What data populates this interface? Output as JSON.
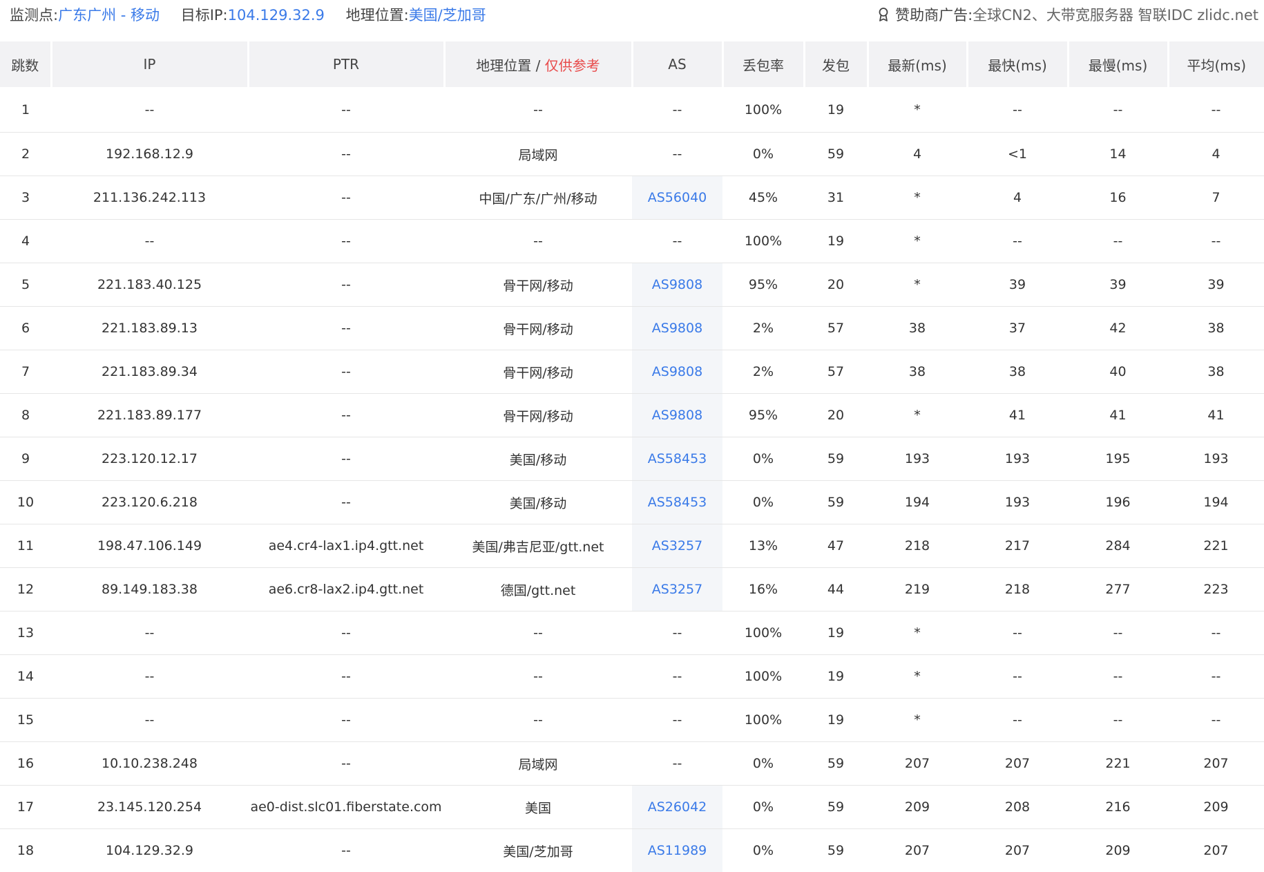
{
  "header": {
    "monitor_label": "监测点:",
    "monitor_value": "广东广州 - 移动",
    "target_label": "目标IP:",
    "target_value": "104.129.32.9",
    "geo_label": "地理位置:",
    "geo_value": "美国/芝加哥",
    "sponsor_label": "赞助商广告:",
    "sponsor_text": "全球CN2、大带宽服务器 智联IDC zlidc.net",
    "sponsor_icon": "ribbon-award-icon"
  },
  "table": {
    "headers": {
      "hop": "跳数",
      "ip": "IP",
      "ptr": "PTR",
      "geo": "地理位置 / ",
      "geo_note": "仅供参考",
      "as": "AS",
      "loss": "丢包率",
      "sent": "发包",
      "last": "最新(ms)",
      "best": "最快(ms)",
      "worst": "最慢(ms)",
      "avg": "平均(ms)"
    },
    "rows": [
      {
        "hop": "1",
        "ip": "--",
        "ptr": "--",
        "geo": "--",
        "as": "--",
        "loss": "100%",
        "sent": "19",
        "last": "*",
        "best": "--",
        "worst": "--",
        "avg": "--"
      },
      {
        "hop": "2",
        "ip": "192.168.12.9",
        "ptr": "--",
        "geo": "局域网",
        "as": "--",
        "loss": "0%",
        "sent": "59",
        "last": "4",
        "best": "<1",
        "worst": "14",
        "avg": "4"
      },
      {
        "hop": "3",
        "ip": "211.136.242.113",
        "ptr": "--",
        "geo": "中国/广东/广州/移动",
        "as": "AS56040",
        "loss": "45%",
        "sent": "31",
        "last": "*",
        "best": "4",
        "worst": "16",
        "avg": "7"
      },
      {
        "hop": "4",
        "ip": "--",
        "ptr": "--",
        "geo": "--",
        "as": "--",
        "loss": "100%",
        "sent": "19",
        "last": "*",
        "best": "--",
        "worst": "--",
        "avg": "--"
      },
      {
        "hop": "5",
        "ip": "221.183.40.125",
        "ptr": "--",
        "geo": "骨干网/移动",
        "as": "AS9808",
        "loss": "95%",
        "sent": "20",
        "last": "*",
        "best": "39",
        "worst": "39",
        "avg": "39"
      },
      {
        "hop": "6",
        "ip": "221.183.89.13",
        "ptr": "--",
        "geo": "骨干网/移动",
        "as": "AS9808",
        "loss": "2%",
        "sent": "57",
        "last": "38",
        "best": "37",
        "worst": "42",
        "avg": "38"
      },
      {
        "hop": "7",
        "ip": "221.183.89.34",
        "ptr": "--",
        "geo": "骨干网/移动",
        "as": "AS9808",
        "loss": "2%",
        "sent": "57",
        "last": "38",
        "best": "38",
        "worst": "40",
        "avg": "38"
      },
      {
        "hop": "8",
        "ip": "221.183.89.177",
        "ptr": "--",
        "geo": "骨干网/移动",
        "as": "AS9808",
        "loss": "95%",
        "sent": "20",
        "last": "*",
        "best": "41",
        "worst": "41",
        "avg": "41"
      },
      {
        "hop": "9",
        "ip": "223.120.12.17",
        "ptr": "--",
        "geo": "美国/移动",
        "as": "AS58453",
        "loss": "0%",
        "sent": "59",
        "last": "193",
        "best": "193",
        "worst": "195",
        "avg": "193"
      },
      {
        "hop": "10",
        "ip": "223.120.6.218",
        "ptr": "--",
        "geo": "美国/移动",
        "as": "AS58453",
        "loss": "0%",
        "sent": "59",
        "last": "194",
        "best": "193",
        "worst": "196",
        "avg": "194"
      },
      {
        "hop": "11",
        "ip": "198.47.106.149",
        "ptr": "ae4.cr4-lax1.ip4.gtt.net",
        "geo": "美国/弗吉尼亚/gtt.net",
        "as": "AS3257",
        "loss": "13%",
        "sent": "47",
        "last": "218",
        "best": "217",
        "worst": "284",
        "avg": "221"
      },
      {
        "hop": "12",
        "ip": "89.149.183.38",
        "ptr": "ae6.cr8-lax2.ip4.gtt.net",
        "geo": "德国/gtt.net",
        "as": "AS3257",
        "loss": "16%",
        "sent": "44",
        "last": "219",
        "best": "218",
        "worst": "277",
        "avg": "223"
      },
      {
        "hop": "13",
        "ip": "--",
        "ptr": "--",
        "geo": "--",
        "as": "--",
        "loss": "100%",
        "sent": "19",
        "last": "*",
        "best": "--",
        "worst": "--",
        "avg": "--"
      },
      {
        "hop": "14",
        "ip": "--",
        "ptr": "--",
        "geo": "--",
        "as": "--",
        "loss": "100%",
        "sent": "19",
        "last": "*",
        "best": "--",
        "worst": "--",
        "avg": "--"
      },
      {
        "hop": "15",
        "ip": "--",
        "ptr": "--",
        "geo": "--",
        "as": "--",
        "loss": "100%",
        "sent": "19",
        "last": "*",
        "best": "--",
        "worst": "--",
        "avg": "--"
      },
      {
        "hop": "16",
        "ip": "10.10.238.248",
        "ptr": "--",
        "geo": "局域网",
        "as": "--",
        "loss": "0%",
        "sent": "59",
        "last": "207",
        "best": "207",
        "worst": "221",
        "avg": "207"
      },
      {
        "hop": "17",
        "ip": "23.145.120.254",
        "ptr": "ae0-dist.slc01.fiberstate.com",
        "geo": "美国",
        "as": "AS26042",
        "loss": "0%",
        "sent": "59",
        "last": "209",
        "best": "208",
        "worst": "216",
        "avg": "209"
      },
      {
        "hop": "18",
        "ip": "104.129.32.9",
        "ptr": "--",
        "geo": "美国/芝加哥",
        "as": "AS11989",
        "loss": "0%",
        "sent": "59",
        "last": "207",
        "best": "207",
        "worst": "209",
        "avg": "207"
      }
    ]
  },
  "colors": {
    "link_blue": "#3a7ae8",
    "warning_red": "#e84b4b",
    "header_bg": "#f2f2f4",
    "as_cell_bg": "#f4f6f9"
  }
}
